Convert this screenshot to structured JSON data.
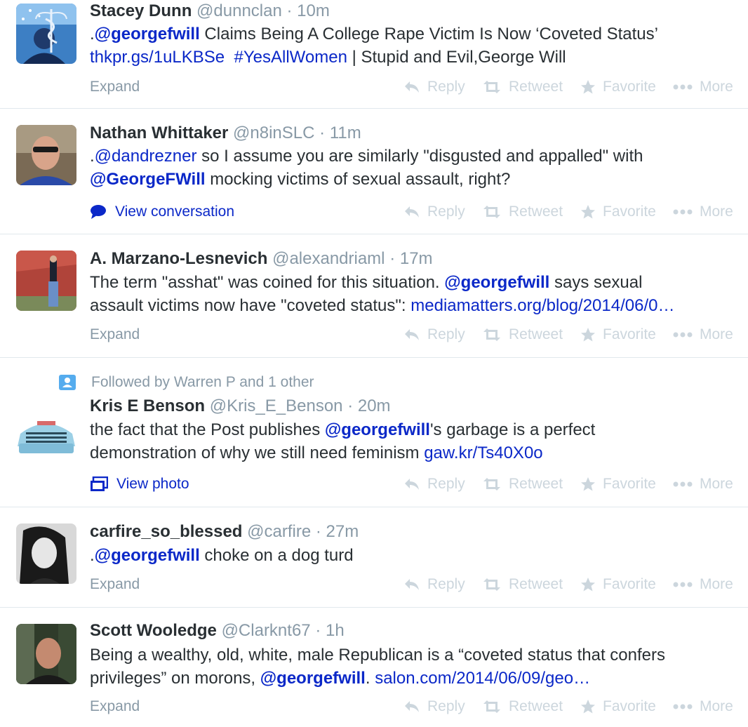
{
  "colors": {
    "link": "#0b28c8",
    "muted": "#8899a6",
    "action": "#ccd6dd",
    "divider": "#e1e8ed"
  },
  "actions": {
    "reply": "Reply",
    "retweet": "Retweet",
    "favorite": "Favorite",
    "more": "More"
  },
  "tweets": [
    {
      "fullname": "Stacey Dunn",
      "username": "@dunnclan",
      "dot": "·",
      "time": "10m",
      "line1": [
        ".",
        "@georgefwill",
        " Claims Being A College Rape Victim Is Now ‘Coveted Status’"
      ],
      "line2": [
        "thkpr.gs/1uLKBSe",
        "#YesAllWomen",
        " | Stupid and Evil,George Will"
      ],
      "footer": "Expand"
    },
    {
      "fullname": "Nathan Whittaker",
      "username": "@n8inSLC",
      "dot": "·",
      "time": "11m",
      "line1": [
        ".",
        "@dandrezner",
        " so I assume you are similarly \"disgusted and appalled\" with"
      ],
      "line2": [
        "@GeorgeFWill",
        " mocking victims of sexual assault, right?"
      ],
      "footer": "View conversation",
      "footer_icon": "speech-bubble-icon"
    },
    {
      "fullname": "A. Marzano-Lesnevich",
      "username": "@alexandriaml",
      "dot": "·",
      "time": "17m",
      "line1": [
        "The term \"asshat\" was coined for this situation. ",
        "@georgefwill",
        " says sexual"
      ],
      "line2": [
        "assault victims now have \"coveted status\": ",
        "mediamatters.org/blog/2014/06/0…"
      ],
      "footer": "Expand"
    },
    {
      "context": "Followed by Warren P and 1 other",
      "context_icon": "person-card-icon",
      "fullname": "Kris E Benson",
      "username": "@Kris_E_Benson",
      "dot": "·",
      "time": "20m",
      "line1": [
        "the fact that the Post publishes ",
        "@georgefwill",
        "'s garbage is a perfect"
      ],
      "line2": [
        "demonstration of why we still need feminism ",
        "gaw.kr/Ts40X0o"
      ],
      "footer": "View photo",
      "footer_icon": "photo-icon"
    },
    {
      "fullname": "carfire_so_blessed",
      "username": "@carfire",
      "dot": "·",
      "time": "27m",
      "line1": [
        ".",
        "@georgefwill",
        " choke on a dog turd"
      ],
      "footer": "Expand"
    },
    {
      "fullname": "Scott Wooledge",
      "username": "@Clarknt67",
      "dot": "·",
      "time": "1h",
      "line1": [
        "Being a wealthy, old, white, male Republican is a “coveted status that confers"
      ],
      "line2": [
        "privileges” on morons, ",
        "@georgefwill",
        ". ",
        "salon.com/2014/06/09/geo…"
      ],
      "footer": "Expand"
    }
  ]
}
